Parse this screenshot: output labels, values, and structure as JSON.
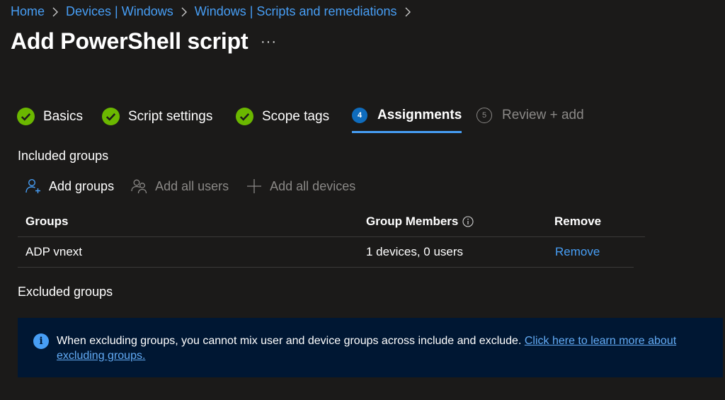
{
  "breadcrumb": [
    "Home",
    "Devices | Windows",
    "Windows | Scripts and remediations"
  ],
  "page": {
    "title": "Add PowerShell script",
    "more": "···"
  },
  "steps": [
    {
      "label": "Basics",
      "state": "done"
    },
    {
      "label": "Script settings",
      "state": "done"
    },
    {
      "label": "Scope tags",
      "state": "done"
    },
    {
      "label": "Assignments",
      "number": "4",
      "state": "active"
    },
    {
      "label": "Review + add",
      "number": "5",
      "state": "pending"
    }
  ],
  "included": {
    "title": "Included groups",
    "toolbar": {
      "add_groups": "Add groups",
      "add_all_users": "Add all users",
      "add_all_devices": "Add all devices"
    },
    "columns": {
      "groups": "Groups",
      "members": "Group Members",
      "remove": "Remove"
    },
    "rows": [
      {
        "group": "ADP vnext",
        "members": "1 devices, 0 users",
        "remove": "Remove"
      }
    ]
  },
  "excluded": {
    "title": "Excluded groups"
  },
  "banner": {
    "text": "When excluding groups, you cannot mix user and device groups across include and exclude. ",
    "link": "Click here to learn more about excluding groups."
  },
  "colors": {
    "accent": "#479ef5",
    "success": "#6bb700",
    "banner_bg": "#001733",
    "page_bg": "#1b1a19"
  }
}
